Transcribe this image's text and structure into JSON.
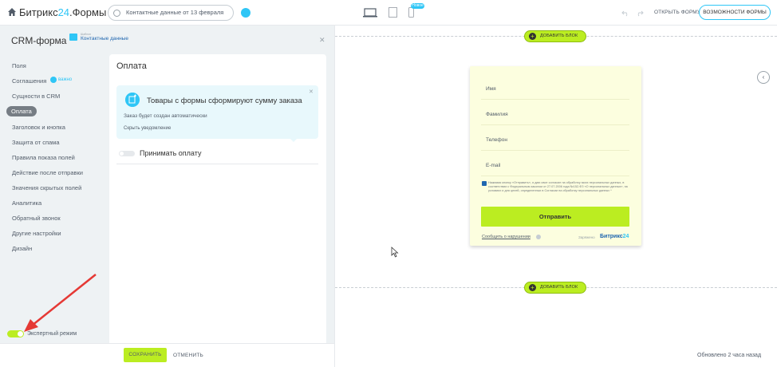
{
  "header": {
    "app_title_main": "Битрикс",
    "app_title_accent": "24",
    "app_title_suffix": ".Формы",
    "form_selector": "Контактные данные от 13 февраля",
    "new_badge": "Новое",
    "open_form": "ОТКРЫТЬ ФОРМУ",
    "features": "ВОЗМОЖНОСТИ ФОРМЫ"
  },
  "sidebar": {
    "title": "CRM-форма",
    "subtitle_small": "Шаблон",
    "subtitle_link": "Контактные данные",
    "important_badge": "важно",
    "items": [
      {
        "label": "Поля"
      },
      {
        "label": "Соглашения"
      },
      {
        "label": "Сущности в CRM"
      },
      {
        "label": "Оплата"
      },
      {
        "label": "Заголовок и кнопка"
      },
      {
        "label": "Защита от спама"
      },
      {
        "label": "Правила показа полей"
      },
      {
        "label": "Действие после отправки"
      },
      {
        "label": "Значения скрытых полей"
      },
      {
        "label": "Аналитика"
      },
      {
        "label": "Обратный звонок"
      },
      {
        "label": "Другие настройки"
      },
      {
        "label": "Дизайн"
      }
    ],
    "expert_mode": "Экспертный режим"
  },
  "settings": {
    "title": "Оплата",
    "info_title": "Товары с формы сформируют сумму заказа",
    "info_note": "Заказ будет создан автоматически",
    "info_hide": "Скрыть уведомление",
    "payment_toggle_label": "Принимать оплату"
  },
  "footer": {
    "save": "СОХРАНИТЬ",
    "cancel": "ОТМЕНИТЬ"
  },
  "preview": {
    "add_block": "ДОБАВИТЬ БЛОК",
    "fields": [
      "Имя",
      "Фамилия",
      "Телефон",
      "E-mail"
    ],
    "consent": "Нажимая кнопку «Отправить», я даю свое согласие на обработку моих персональных данных, в соответствии с Федеральным законом от 27.07.2006 года №152-ФЗ «О персональных данных», на условиях и для целей, определенных в Согласии на обработку персональных данных *",
    "submit": "Отправить",
    "report": "Сообщить о нарушении",
    "powered_label": "Заряжено",
    "powered_brand": "Битрикс",
    "powered_num": "24",
    "updated": "Обновлено 2 часа назад"
  },
  "colors": {
    "accent_blue": "#2fc6f6",
    "accent_green": "#bbed21",
    "annotation_red": "#e53935"
  }
}
